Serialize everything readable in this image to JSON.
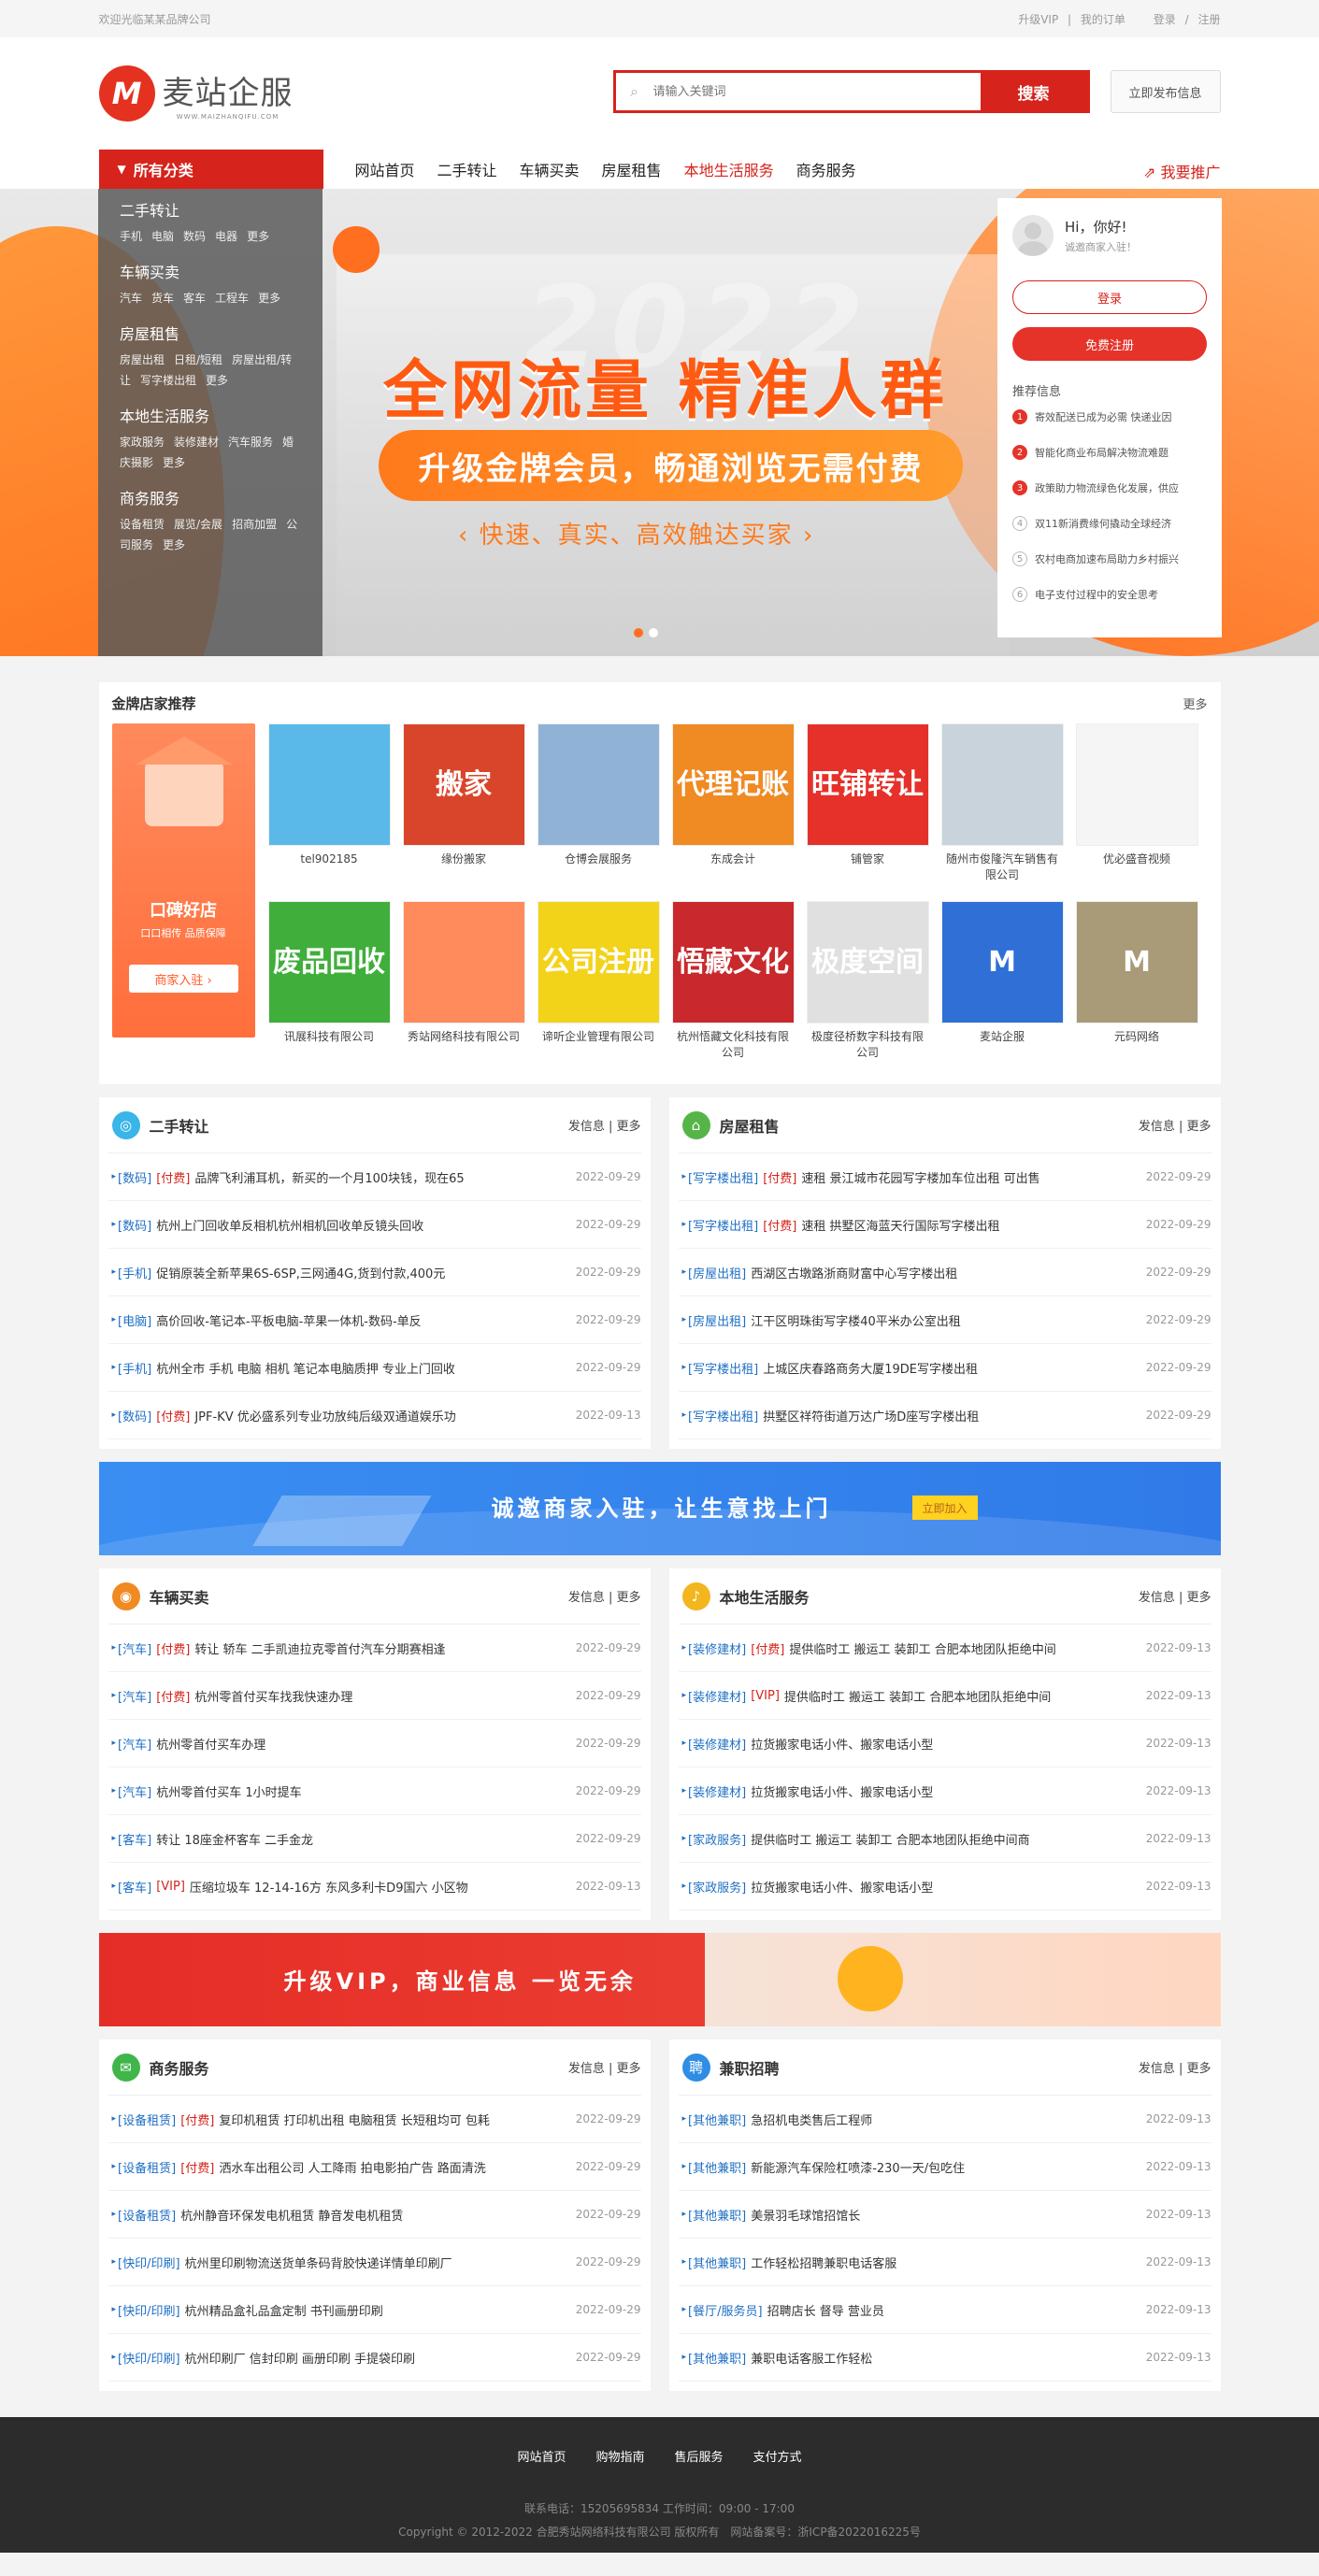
{
  "topbar": {
    "welcome": "欢迎光临某某品牌公司",
    "vip": "升级VIP",
    "sep": "|",
    "orders": "我的订单",
    "login": "登录",
    "slash": "/",
    "register": "注册"
  },
  "logo": {
    "mark": "M",
    "name": "麦站企服",
    "sub": "WWW.MAIZHANQIFU.COM"
  },
  "search": {
    "placeholder": "请输入关键词",
    "button": "搜索"
  },
  "publish_button": "立即发布信息",
  "nav": {
    "all": "所有分类",
    "items": [
      "网站首页",
      "二手转让",
      "车辆买卖",
      "房屋租售",
      "本地生活服务",
      "商务服务"
    ],
    "active_index": 4,
    "promo": "我要推广"
  },
  "categories": [
    {
      "title": "二手转让",
      "links": [
        "手机",
        "电脑",
        "数码",
        "电器",
        "更多"
      ]
    },
    {
      "title": "车辆买卖",
      "links": [
        "汽车",
        "货车",
        "客车",
        "工程车",
        "更多"
      ]
    },
    {
      "title": "房屋租售",
      "links": [
        "房屋出租",
        "日租/短租",
        "房屋出租/转让",
        "写字楼出租",
        "更多"
      ]
    },
    {
      "title": "本地生活服务",
      "links": [
        "家政服务",
        "装修建材",
        "汽车服务",
        "婚庆摄影",
        "更多"
      ]
    },
    {
      "title": "商务服务",
      "links": [
        "设备租赁",
        "展览/会展",
        "招商加盟",
        "公司服务",
        "更多"
      ]
    }
  ],
  "banner": {
    "year": "2022",
    "headline": "全网流量 精准人群",
    "pill": "升级金牌会员，畅通浏览无需付费",
    "tagline": "快速、真实、高效触达买家"
  },
  "user": {
    "hello": "Hi，你好!",
    "invite": "诚邀商家入驻！",
    "login": "登录",
    "register": "免费注册",
    "rec_title": "推荐信息",
    "rec": [
      "寄效配送已成为必需 快递业因",
      "智能化商业布局解决物流难题",
      "政策助力物流绿色化发展，供应",
      "双11新消费缘何撬动全球经济",
      "农村电商加速布局助力乡村振兴",
      "电子支付过程中的安全思考"
    ]
  },
  "shops": {
    "title": "金牌店家推荐",
    "more": "更多",
    "promo_title": "口碑好店",
    "promo_sub": "口口相传 品质保障",
    "promo_btn": "商家入驻 ›",
    "items": [
      {
        "name": "tel902185",
        "img": "",
        "bg": "#5ab9e8"
      },
      {
        "name": "缘份搬家",
        "img": "搬家",
        "bg": "#d9452a"
      },
      {
        "name": "仓博会展服务",
        "img": "",
        "bg": "#8fb2d6"
      },
      {
        "name": "东成会计",
        "img": "代理记账",
        "bg": "#f08a23"
      },
      {
        "name": "铺管家",
        "img": "旺铺转让",
        "bg": "#e5312a"
      },
      {
        "name": "随州市俊隆汽车销售有限公司",
        "img": "",
        "bg": "#c9d3dc"
      },
      {
        "name": "优必盛音视频",
        "img": "",
        "bg": "#f5f5f5"
      },
      {
        "name": "讯展科技有限公司",
        "img": "废品回收",
        "bg": "#3fae3a"
      },
      {
        "name": "秀站网络科技有限公司",
        "img": "",
        "bg": "#ff8a5c"
      },
      {
        "name": "谛听企业管理有限公司",
        "img": "公司注册",
        "bg": "#f3d21a"
      },
      {
        "name": "杭州悟藏文化科技有限公司",
        "img": "悟藏文化",
        "bg": "#c9282c"
      },
      {
        "name": "极度径桥数字科技有限公司",
        "img": "极度空间",
        "bg": "#e0e0e0"
      },
      {
        "name": "麦站企服",
        "img": "M",
        "bg": "#2f6fd6"
      },
      {
        "name": "元码网络",
        "img": "M",
        "bg": "#a99a78"
      }
    ]
  },
  "lists": [
    {
      "title": "二手转让",
      "icon": "◎",
      "color": "#39b5e8",
      "more": "发信息 | 更多",
      "items": [
        {
          "cat": "[数码]",
          "paid": "[付费]",
          "text": "品牌飞利浦耳机，新买的一个月100块钱，现在65",
          "date": "2022-09-29"
        },
        {
          "cat": "[数码]",
          "paid": "",
          "text": "杭州上门回收单反相机杭州相机回收单反镜头回收",
          "date": "2022-09-29"
        },
        {
          "cat": "[手机]",
          "paid": "",
          "text": "促销原装全新苹果6S-6SP,三网通4G,货到付款,400元",
          "date": "2022-09-29"
        },
        {
          "cat": "[电脑]",
          "paid": "",
          "text": "高价回收-笔记本-平板电脑-苹果一体机-数码-单反",
          "date": "2022-09-29"
        },
        {
          "cat": "[手机]",
          "paid": "",
          "text": "杭州全市 手机 电脑 相机 笔记本电脑质押 专业上门回收",
          "date": "2022-09-29"
        },
        {
          "cat": "[数码]",
          "paid": "[付费]",
          "text": "JPF-KV 优必盛系列专业功放纯后级双通道娱乐功",
          "date": "2022-09-13"
        }
      ]
    },
    {
      "title": "房屋租售",
      "icon": "⌂",
      "color": "#55b548",
      "more": "发信息 | 更多",
      "items": [
        {
          "cat": "[写字楼出租]",
          "paid": "[付费]",
          "text": "速租 景江城市花园写字楼加车位出租 可出售",
          "date": "2022-09-29"
        },
        {
          "cat": "[写字楼出租]",
          "paid": "[付费]",
          "text": "速租 拱墅区海蓝天行国际写字楼出租",
          "date": "2022-09-29"
        },
        {
          "cat": "[房屋出租]",
          "paid": "",
          "text": "西湖区古墩路浙商财富中心写字楼出租",
          "date": "2022-09-29"
        },
        {
          "cat": "[房屋出租]",
          "paid": "",
          "text": "江干区明珠街写字楼40平米办公室出租",
          "date": "2022-09-29"
        },
        {
          "cat": "[写字楼出租]",
          "paid": "",
          "text": "上城区庆春路商务大厦19DE写字楼出租",
          "date": "2022-09-29"
        },
        {
          "cat": "[写字楼出租]",
          "paid": "",
          "text": "拱墅区祥符街道万达广场D座写字楼出租",
          "date": "2022-09-29"
        }
      ]
    },
    {
      "title": "车辆买卖",
      "icon": "◉",
      "color": "#f08a23",
      "more": "发信息 | 更多",
      "items": [
        {
          "cat": "[汽车]",
          "paid": "[付费]",
          "text": "转让 轿车 二手凯迪拉克零首付汽车分期赛相逢",
          "date": "2022-09-29"
        },
        {
          "cat": "[汽车]",
          "paid": "[付费]",
          "text": "杭州零首付买车找我快速办理",
          "date": "2022-09-29"
        },
        {
          "cat": "[汽车]",
          "paid": "",
          "text": "杭州零首付买车办理",
          "date": "2022-09-29"
        },
        {
          "cat": "[汽车]",
          "paid": "",
          "text": "杭州零首付买车 1小时提车",
          "date": "2022-09-29"
        },
        {
          "cat": "[客车]",
          "paid": "",
          "text": "转让 18座金杯客车 二手金龙",
          "date": "2022-09-29"
        },
        {
          "cat": "[客车]",
          "paid": "[VIP]",
          "text": "压缩垃圾车 12-14-16方 东风多利卡D9国六 小区物",
          "date": "2022-09-13"
        }
      ]
    },
    {
      "title": "本地生活服务",
      "icon": "♪",
      "color": "#f3b61f",
      "more": "发信息 | 更多",
      "items": [
        {
          "cat": "[装修建材]",
          "paid": "[付费]",
          "text": "提供临时工 搬运工 装卸工 合肥本地团队拒绝中间",
          "date": "2022-09-13"
        },
        {
          "cat": "[装修建材]",
          "paid": "[VIP]",
          "text": "提供临时工 搬运工 装卸工 合肥本地团队拒绝中间",
          "date": "2022-09-13"
        },
        {
          "cat": "[装修建材]",
          "paid": "",
          "text": "拉货搬家电话小件、搬家电话小型",
          "date": "2022-09-13"
        },
        {
          "cat": "[装修建材]",
          "paid": "",
          "text": "拉货搬家电话小件、搬家电话小型",
          "date": "2022-09-13"
        },
        {
          "cat": "[家政服务]",
          "paid": "",
          "text": "提供临时工 搬运工 装卸工 合肥本地团队拒绝中间商",
          "date": "2022-09-13"
        },
        {
          "cat": "[家政服务]",
          "paid": "",
          "text": "拉货搬家电话小件、搬家电话小型",
          "date": "2022-09-13"
        }
      ]
    },
    {
      "title": "商务服务",
      "icon": "✉",
      "color": "#3fb54a",
      "more": "发信息 | 更多",
      "items": [
        {
          "cat": "[设备租赁]",
          "paid": "[付费]",
          "text": "复印机租赁 打印机出租 电脑租赁 长短租均可 包耗",
          "date": "2022-09-29"
        },
        {
          "cat": "[设备租赁]",
          "paid": "[付费]",
          "text": "洒水车出租公司 人工降雨 拍电影拍广告 路面清洗",
          "date": "2022-09-29"
        },
        {
          "cat": "[设备租赁]",
          "paid": "",
          "text": "杭州静音环保发电机租赁 静音发电机租赁",
          "date": "2022-09-29"
        },
        {
          "cat": "[快印/印刷]",
          "paid": "",
          "text": "杭州里印刷物流送货单条码背胶快递详情单印刷厂",
          "date": "2022-09-29"
        },
        {
          "cat": "[快印/印刷]",
          "paid": "",
          "text": "杭州精品盒礼品盒定制 书刊画册印刷",
          "date": "2022-09-29"
        },
        {
          "cat": "[快印/印刷]",
          "paid": "",
          "text": "杭州印刷厂 信封印刷 画册印刷 手提袋印刷",
          "date": "2022-09-29"
        }
      ]
    },
    {
      "title": "兼职招聘",
      "icon": "聘",
      "color": "#2f8de4",
      "more": "发信息 | 更多",
      "items": [
        {
          "cat": "[其他兼职]",
          "paid": "",
          "text": "急招机电类售后工程师",
          "date": "2022-09-13"
        },
        {
          "cat": "[其他兼职]",
          "paid": "",
          "text": "新能源汽车保险杠喷漆-230一天/包吃住",
          "date": "2022-09-13"
        },
        {
          "cat": "[其他兼职]",
          "paid": "",
          "text": "美景羽毛球馆招馆长",
          "date": "2022-09-13"
        },
        {
          "cat": "[其他兼职]",
          "paid": "",
          "text": "工作轻松招聘兼职电话客服",
          "date": "2022-09-13"
        },
        {
          "cat": "[餐厅/服务员]",
          "paid": "",
          "text": "招聘店长 督导 营业员",
          "date": "2022-09-13"
        },
        {
          "cat": "[其他兼职]",
          "paid": "",
          "text": "兼职电话客服工作轻松",
          "date": "2022-09-13"
        }
      ]
    }
  ],
  "ad1": {
    "text": "诚邀商家入驻，让生意找上门",
    "button": "立即加入"
  },
  "ad2": {
    "text": "升级VIP，商业信息 一览无余"
  },
  "footer": {
    "links": [
      "网站首页",
      "购物指南",
      "售后服务",
      "支付方式"
    ],
    "contact": "联系电话：15205695834 工作时间：09:00 - 17:00",
    "copyright": "Copyright © 2012-2022 合肥秀站网络科技有限公司 版权所有　网站备案号：浙ICP备2022016225号"
  }
}
